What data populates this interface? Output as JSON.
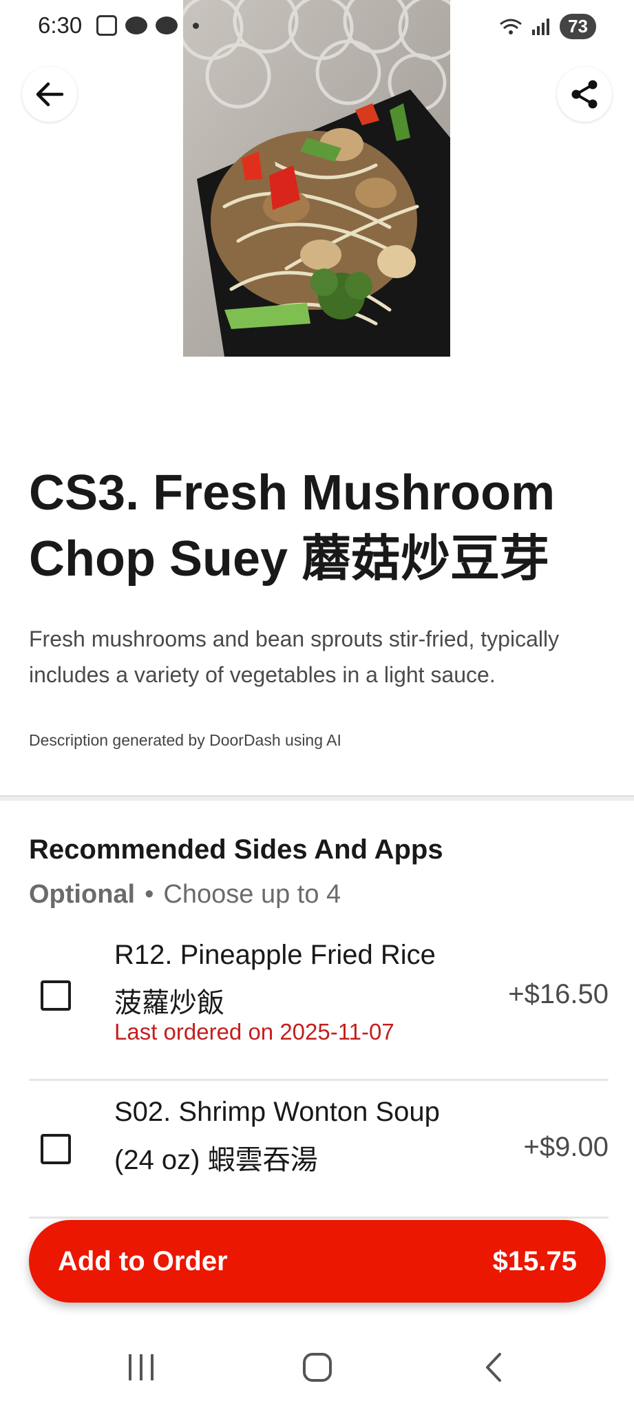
{
  "status_bar": {
    "time": "6:30",
    "battery": "73"
  },
  "header": {
    "back_icon": "arrow-left-icon",
    "share_icon": "share-icon",
    "image_alt": "Fresh Mushroom Chop Suey photo"
  },
  "item": {
    "title": "CS3. Fresh Mushroom Chop Suey 蘑菇炒豆芽",
    "description": "Fresh mushrooms and bean sprouts stir-fried, typically includes a variety of vegetables in a light sauce.",
    "ai_note": "Description generated by DoorDash using AI"
  },
  "options_section": {
    "title": "Recommended Sides And Apps",
    "optional_label": "Optional",
    "separator": "•",
    "choose_label": "Choose up to 4",
    "items": [
      {
        "name": "R12. Pineapple Fried Rice 菠蘿炒飯",
        "last_ordered": "Last ordered on 2025-11-07",
        "price": "+$16.50"
      },
      {
        "name": "S02. Shrimp Wonton Soup (24 oz) 蝦雲吞湯",
        "price": "+$9.00"
      }
    ]
  },
  "cta": {
    "label": "Add to Order",
    "price": "$15.75"
  },
  "colors": {
    "brand_red": "#eb1700",
    "last_ordered_red": "#c41e1e"
  }
}
